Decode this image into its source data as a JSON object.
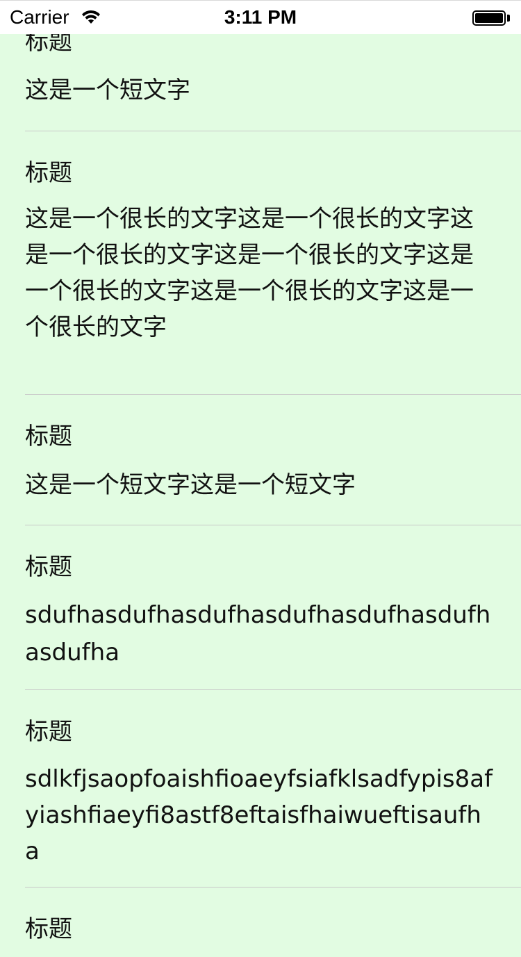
{
  "status_bar": {
    "carrier": "Carrier",
    "time": "3:11 PM"
  },
  "cells": [
    {
      "title": "标题",
      "body": "这是一个短文字"
    },
    {
      "title": "标题",
      "body": "这是一个很长的文字这是一个很长的文字这是一个很长的文字这是一个很长的文字这是一个很长的文字这是一个很长的文字这是一个很长的文字"
    },
    {
      "title": "标题",
      "body": "这是一个短文字这是一个短文字"
    },
    {
      "title": "标题",
      "body": "sdufhasdufhasdufhasdufhasdufhasdufhasdufha"
    },
    {
      "title": "标题",
      "body": "sdlkfjsaopfoaishfioaeyfsiafklsadfypis8afyiashfiaeyfi8astf8eftaisfhaiwueftisaufha"
    },
    {
      "title": "标题"
    }
  ],
  "colors": {
    "background": "#E2FCE2",
    "separator": "#C8C8C8"
  }
}
